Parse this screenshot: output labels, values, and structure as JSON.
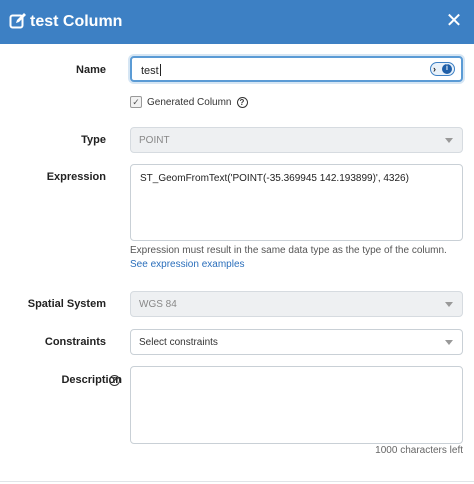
{
  "header": {
    "title": "test Column",
    "close_symbol": "✕",
    "color": "#3d80c4"
  },
  "name": {
    "label": "Name",
    "value": "test"
  },
  "generated": {
    "label": "Generated Column",
    "checked": true
  },
  "type": {
    "label": "Type",
    "value": "POINT"
  },
  "expression": {
    "label": "Expression",
    "value": "ST_GeomFromText('POINT(-35.369945 142.193899)', 4326)",
    "hint": "Expression must result in the same data type as the type of the column.",
    "link": "See expression examples"
  },
  "spatial": {
    "label": "Spatial System",
    "value": "WGS 84"
  },
  "constraints": {
    "label": "Constraints",
    "placeholder": "Select constraints"
  },
  "description": {
    "label": "Description",
    "counter": "1000 characters left"
  }
}
